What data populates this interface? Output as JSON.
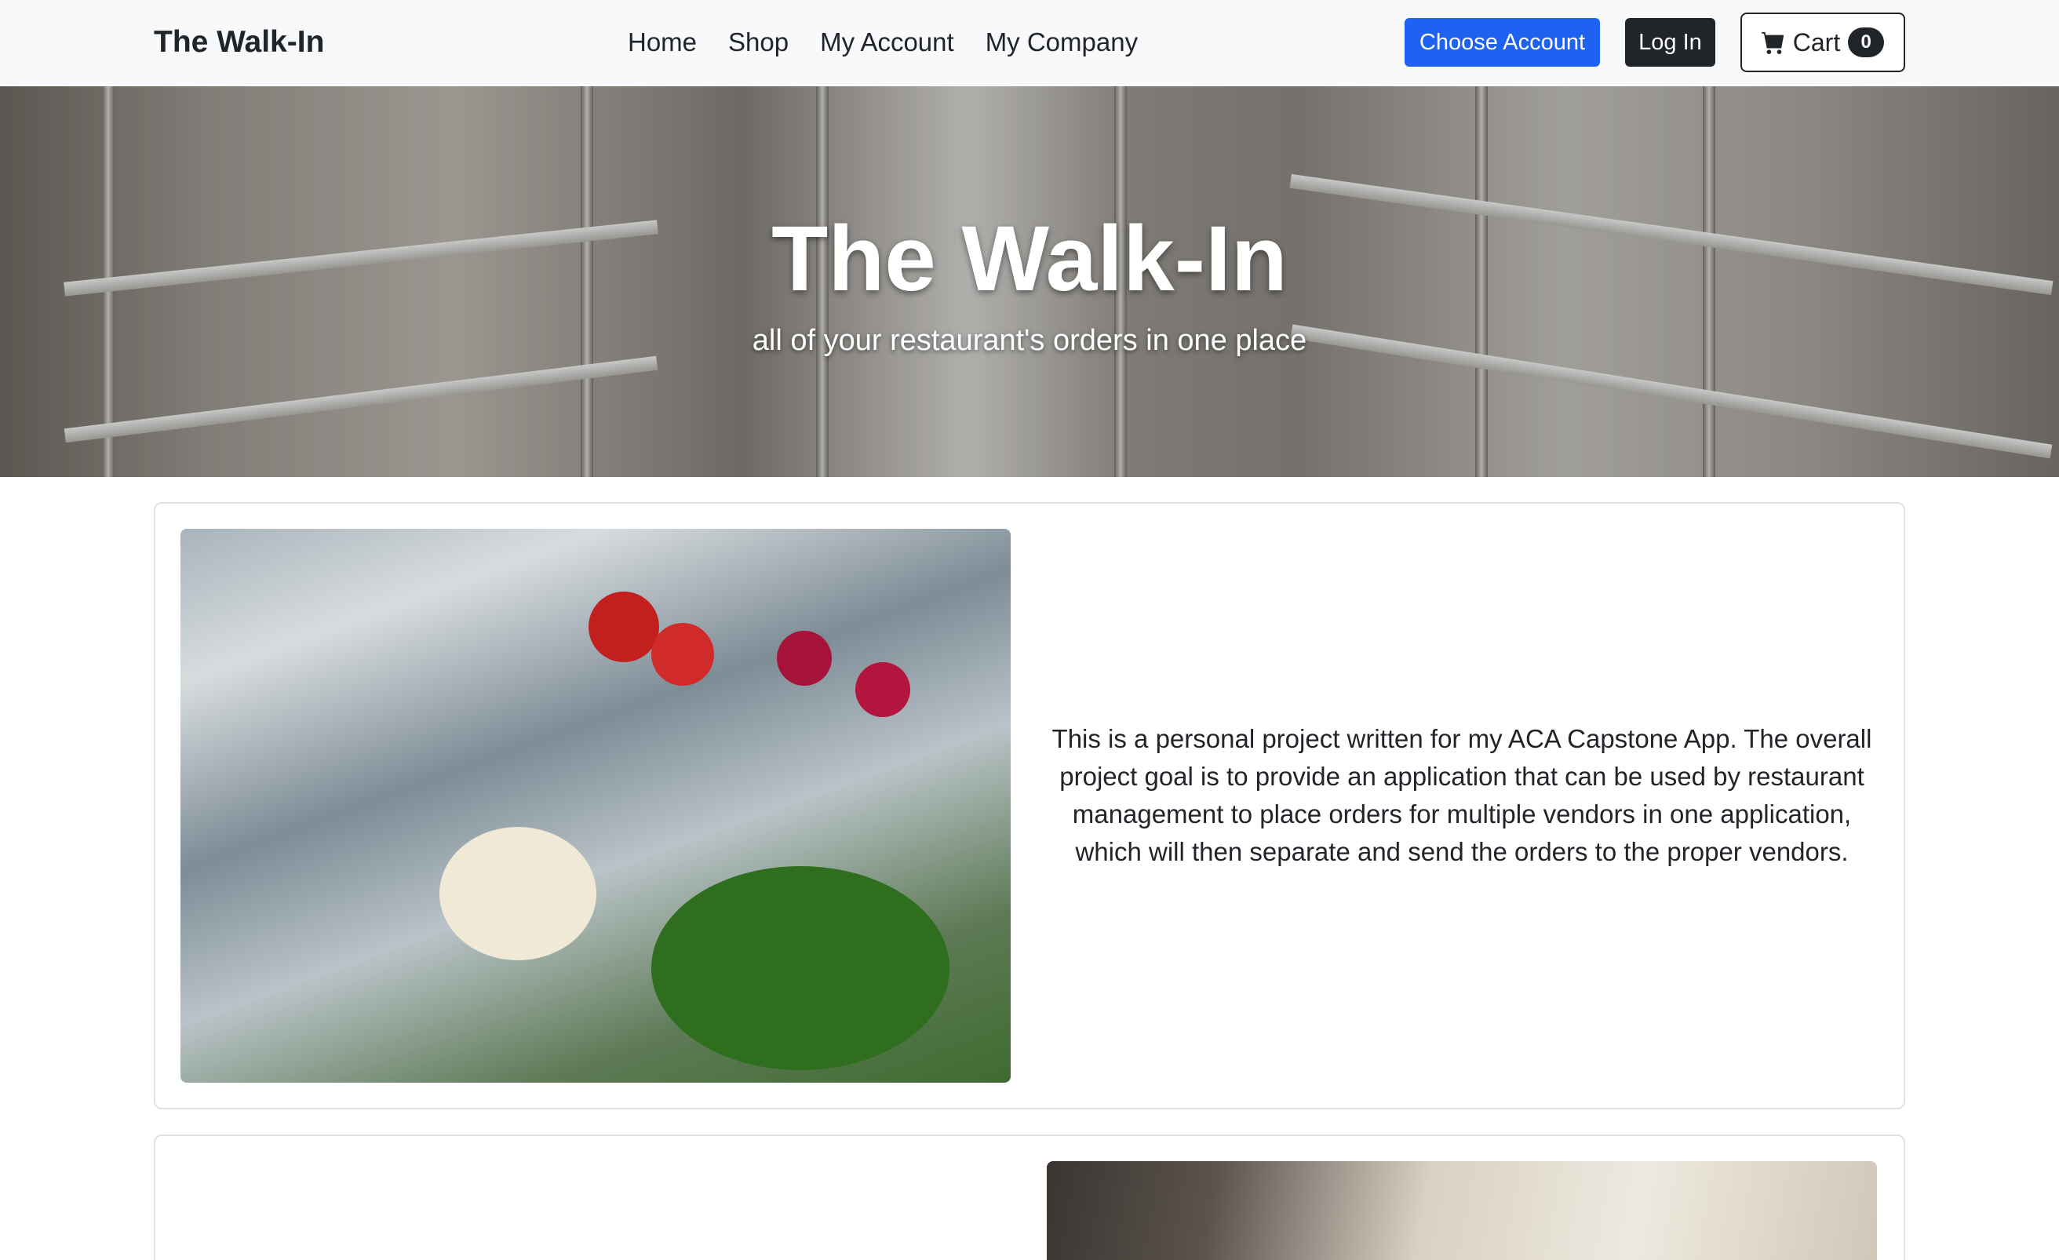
{
  "navbar": {
    "brand": "The Walk-In",
    "links": [
      "Home",
      "Shop",
      "My Account",
      "My Company"
    ],
    "choose_account_label": "Choose Account",
    "login_label": "Log In",
    "cart_label": "Cart",
    "cart_count": "0"
  },
  "hero": {
    "title": "The Walk-In",
    "subtitle": "all of your restaurant's orders in one place"
  },
  "cards": [
    {
      "text": "This is a personal project written for my ACA Capstone App. The overall project goal is to provide an application that can be used by restaurant management to place orders for multiple vendors in one application, which will then separate and send the orders to the proper vendors."
    }
  ],
  "colors": {
    "primary": "#1f62f1",
    "dark": "#212529",
    "navbar_bg": "#f8f9fa"
  }
}
